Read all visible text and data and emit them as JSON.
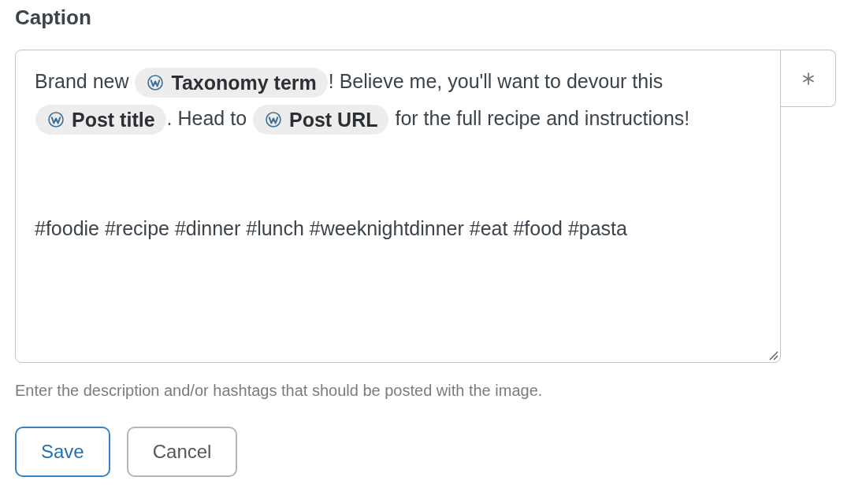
{
  "label": "Caption",
  "caption": {
    "paragraphs": [
      {
        "segments": [
          {
            "kind": "text",
            "text": "Brand new "
          },
          {
            "kind": "tag",
            "text": "Taxonomy term"
          },
          {
            "kind": "text",
            "text": "! Believe me, you'll want to devour this "
          },
          {
            "kind": "tag",
            "text": "Post title"
          },
          {
            "kind": "text",
            "text": ". Head to "
          },
          {
            "kind": "tag",
            "text": "Post URL"
          },
          {
            "kind": "text",
            "text": " for the full recipe and instructions!"
          }
        ]
      },
      {
        "segments": [
          {
            "kind": "text",
            "text": "#foodie #recipe #dinner #lunch #weeknightdinner #eat #food #pasta"
          }
        ]
      }
    ]
  },
  "help": "Enter the description and/or hashtags that should be posted with the image.",
  "buttons": [
    {
      "label": "Save",
      "kind": "primary"
    },
    {
      "label": "Cancel",
      "kind": "secondary"
    }
  ]
}
